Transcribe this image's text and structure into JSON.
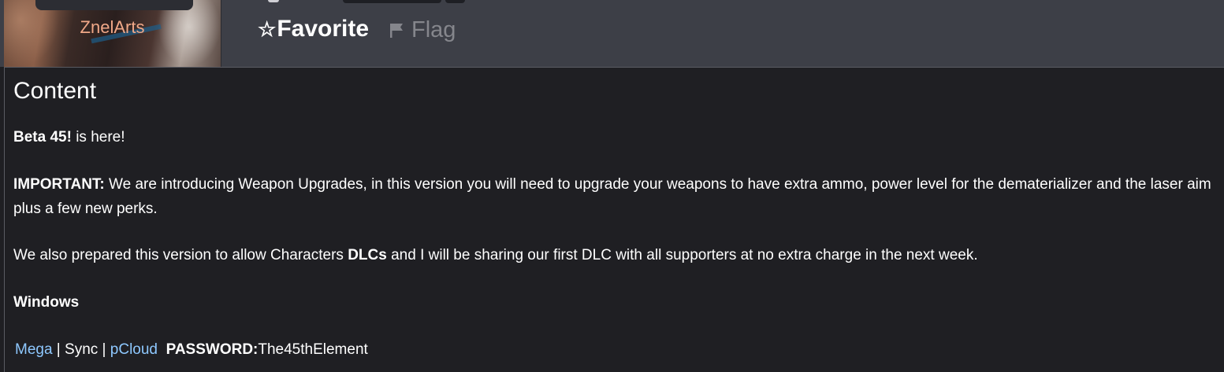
{
  "author": {
    "name": "ZnelArts"
  },
  "actions": {
    "favorite_star": "☆",
    "favorite_label": "Favorite",
    "flag_label": "Flag"
  },
  "content": {
    "title": "Content",
    "intro_bold": "Beta 45!",
    "intro_rest": " is here!",
    "important_bold": "IMPORTANT:",
    "important_rest": " We are introducing Weapon Upgrades, in this version you will need to upgrade your weapons to have extra ammo, power level for the dematerializer and the laser aim plus a few new perks.",
    "dlc_pre": "We also prepared this version to allow Characters ",
    "dlc_bold": "DLCs",
    "dlc_post": " and I will be sharing our first DLC with all supporters at no extra charge in the next week.",
    "platform": "Windows",
    "downloads": {
      "mega": "Mega",
      "sep1": " | ",
      "sync": "Sync",
      "sep2": " | ",
      "pcloud": "pCloud",
      "password_label": "PASSWORD:",
      "password_value": "The45thElement"
    }
  },
  "colors": {
    "background": "#1f1f23",
    "header": "#3d3f47",
    "link": "#8ec8ff",
    "author": "#f0a888"
  }
}
